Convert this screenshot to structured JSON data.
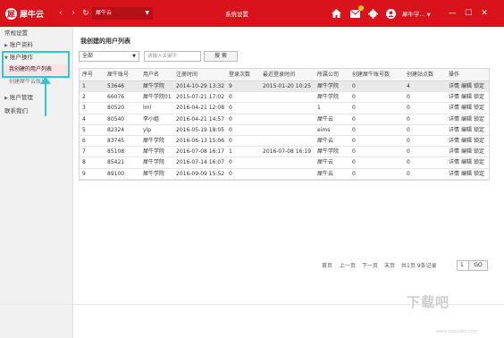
{
  "app": {
    "logo_text": "犀牛云",
    "logo_mark": "犀",
    "window_title": "系统设置",
    "account_select": "犀牛云",
    "user_name": "犀牛学...",
    "accent": "#d8131c"
  },
  "sidebar": {
    "items": [
      {
        "label": "常规设置",
        "type": "item"
      },
      {
        "label": "账户资料",
        "type": "group",
        "arrow": "▶"
      },
      {
        "label": "账户操作",
        "type": "group",
        "arrow": "▼"
      },
      {
        "label": "我创建的用户列表",
        "type": "sub",
        "active": true
      },
      {
        "label": "创建犀牛云账号",
        "type": "sub"
      },
      {
        "label": "账户管理",
        "type": "group",
        "arrow": "▶"
      },
      {
        "label": "联系我们",
        "type": "item"
      }
    ]
  },
  "main": {
    "title": "我创建的用户列表",
    "filter_value": "全部",
    "search_placeholder": "请输入关键字",
    "search_label": "搜 索"
  },
  "table": {
    "columns": [
      "序号",
      "犀牛账号",
      "用户名",
      "注册时间",
      "登录次数",
      "最近登录时间",
      "所属公司",
      "创建犀牛账号数",
      "创建站点数",
      "操作"
    ],
    "rows": [
      [
        "1",
        "53646",
        "犀牛学院",
        "2014-10-29 13:32",
        "9",
        "2015-01-20 10:25",
        "犀牛学院",
        "0",
        "4"
      ],
      [
        "2",
        "66076",
        "犀牛学院01",
        "2015-07-21 17:02",
        "0",
        "",
        "犀牛学院",
        "0",
        "0"
      ],
      [
        "3",
        "80520",
        "lml",
        "2016-04-21 12:08",
        "0",
        "",
        "1",
        "0",
        "0"
      ],
      [
        "4",
        "80540",
        "李小姐",
        "2016-04-21 14:57",
        "0",
        "",
        "犀牛云",
        "0",
        "0"
      ],
      [
        "5",
        "82324",
        "ylp",
        "2016-05-19 18:05",
        "0",
        "",
        "eims",
        "0",
        "0"
      ],
      [
        "6",
        "83745",
        "犀牛学院",
        "2016-06-13 15:06",
        "0",
        "",
        "犀牛云",
        "0",
        "0"
      ],
      [
        "7",
        "85108",
        "犀牛学院",
        "2016-07-08 16:17",
        "1",
        "2016-07-08 16:19",
        "犀牛学院",
        "0",
        "0"
      ],
      [
        "8",
        "85421",
        "犀牛学院",
        "2016-07-14 16:07",
        "0",
        "",
        "犀牛云",
        "0",
        "0"
      ],
      [
        "9",
        "89100",
        "犀牛学院",
        "2016-09-09 15:52",
        "0",
        "",
        "犀牛云",
        "0",
        "0"
      ]
    ],
    "actions": [
      "详情",
      "编辑",
      "锁定"
    ]
  },
  "pager": {
    "first": "首页",
    "prev": "上一页",
    "next": "下一页",
    "last": "末页",
    "summary": "共1页 9条记录",
    "page_size": "1",
    "go": "GO"
  },
  "watermark": {
    "text": "下载吧",
    "sub": "www.xiazaiba.com"
  }
}
